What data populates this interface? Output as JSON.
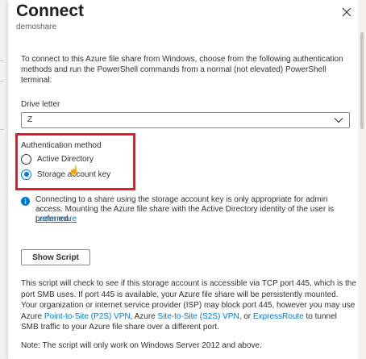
{
  "panel": {
    "title": "Connect",
    "subtitle": "demoshare",
    "close_icon": "close-icon"
  },
  "intro": "To connect to this Azure file share from Windows, choose from the following authentication methods and run the PowerShell commands from a normal (not elevated) PowerShell terminal:",
  "drive_letter": {
    "label": "Drive letter",
    "value": "Z",
    "icon": "chevron-down-icon"
  },
  "auth": {
    "label": "Authentication method",
    "options": [
      {
        "label": "Active Directory",
        "checked": false
      },
      {
        "label": "Storage account key",
        "checked": true
      }
    ],
    "highlight_color": "#e81b23"
  },
  "info": {
    "icon": "info-icon",
    "text": "Connecting to a share using the storage account key is only appropriate for admin access. Mounting the Azure file share with the Active Directory identity of the user is preferred.",
    "link": "Learn more"
  },
  "show_script_button": "Show Script",
  "script_description": {
    "part1": "This script will check to see if this storage account is accessible via TCP port 445, which is the port SMB uses. If port 445 is available, your Azure file share will be persistently mounted. Your organization or internet service provider (ISP) may block port 445, however you may use Azure ",
    "link1": "Point-to-Site (P2S) VPN",
    "part2": ", Azure ",
    "link2": "Site-to-Site (S2S) VPN",
    "part3": ", or ",
    "link3": "ExpressRoute",
    "part4": " to tunnel SMB traffic to your Azure file share over a different port."
  },
  "note": "Note: The script will only work on Windows Server 2012 and above.",
  "colors": {
    "accent": "#0078d4",
    "text": "#323130"
  }
}
